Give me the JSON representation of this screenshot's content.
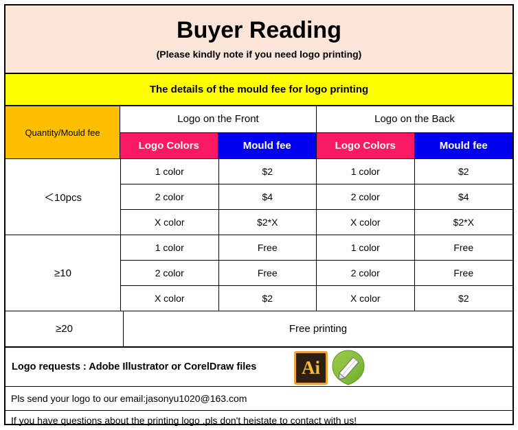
{
  "banner": {
    "title": "Buyer Reading",
    "subtitle": "(Please kindly note if you need logo printing)",
    "background": "#FBE4D8"
  },
  "yellow_strip": {
    "text": "The details of the mould fee for logo printing",
    "background": "#FFFF00"
  },
  "table": {
    "corner_header": "Quantity/Mould fee",
    "corner_background": "#FFBF00",
    "side_headers": [
      "Logo on the Front",
      "Logo on the Back"
    ],
    "sub_headers": [
      "Logo Colors",
      "Mould fee"
    ],
    "sub_header_colors": {
      "colors": "#FA1A64",
      "fee": "#0000EE"
    },
    "groups": [
      {
        "label": "＜10pcs",
        "rows": [
          {
            "front_colors": "1 color",
            "front_fee": "$2",
            "back_colors": "1 color",
            "back_fee": "$2"
          },
          {
            "front_colors": "2 color",
            "front_fee": "$4",
            "back_colors": "2 color",
            "back_fee": "$4"
          },
          {
            "front_colors": "X color",
            "front_fee": "$2*X",
            "back_colors": "X color",
            "back_fee": "$2*X"
          }
        ]
      },
      {
        "label": "≥10",
        "rows": [
          {
            "front_colors": "1 color",
            "front_fee": "Free",
            "back_colors": "1 color",
            "back_fee": "Free"
          },
          {
            "front_colors": "2 color",
            "front_fee": "Free",
            "back_colors": "2 color",
            "back_fee": "Free"
          },
          {
            "front_colors": "X color",
            "front_fee": "$2",
            "back_colors": "X color",
            "back_fee": "$2"
          }
        ]
      }
    ],
    "free_row": {
      "label": "≥20",
      "text": "Free printing"
    }
  },
  "footer": {
    "logo_requests": "Logo requests : Adobe Illustrator or CorelDraw files",
    "icons": [
      {
        "name": "adobe-illustrator-icon",
        "label": "Ai"
      },
      {
        "name": "coreldraw-icon",
        "label": "CorelDraw"
      }
    ],
    "email_line": "Pls send your logo to our email:jasonyu1020@163.com",
    "question_line": "If you have questions about the printing logo ,pls don't heistate to contact with us!"
  }
}
